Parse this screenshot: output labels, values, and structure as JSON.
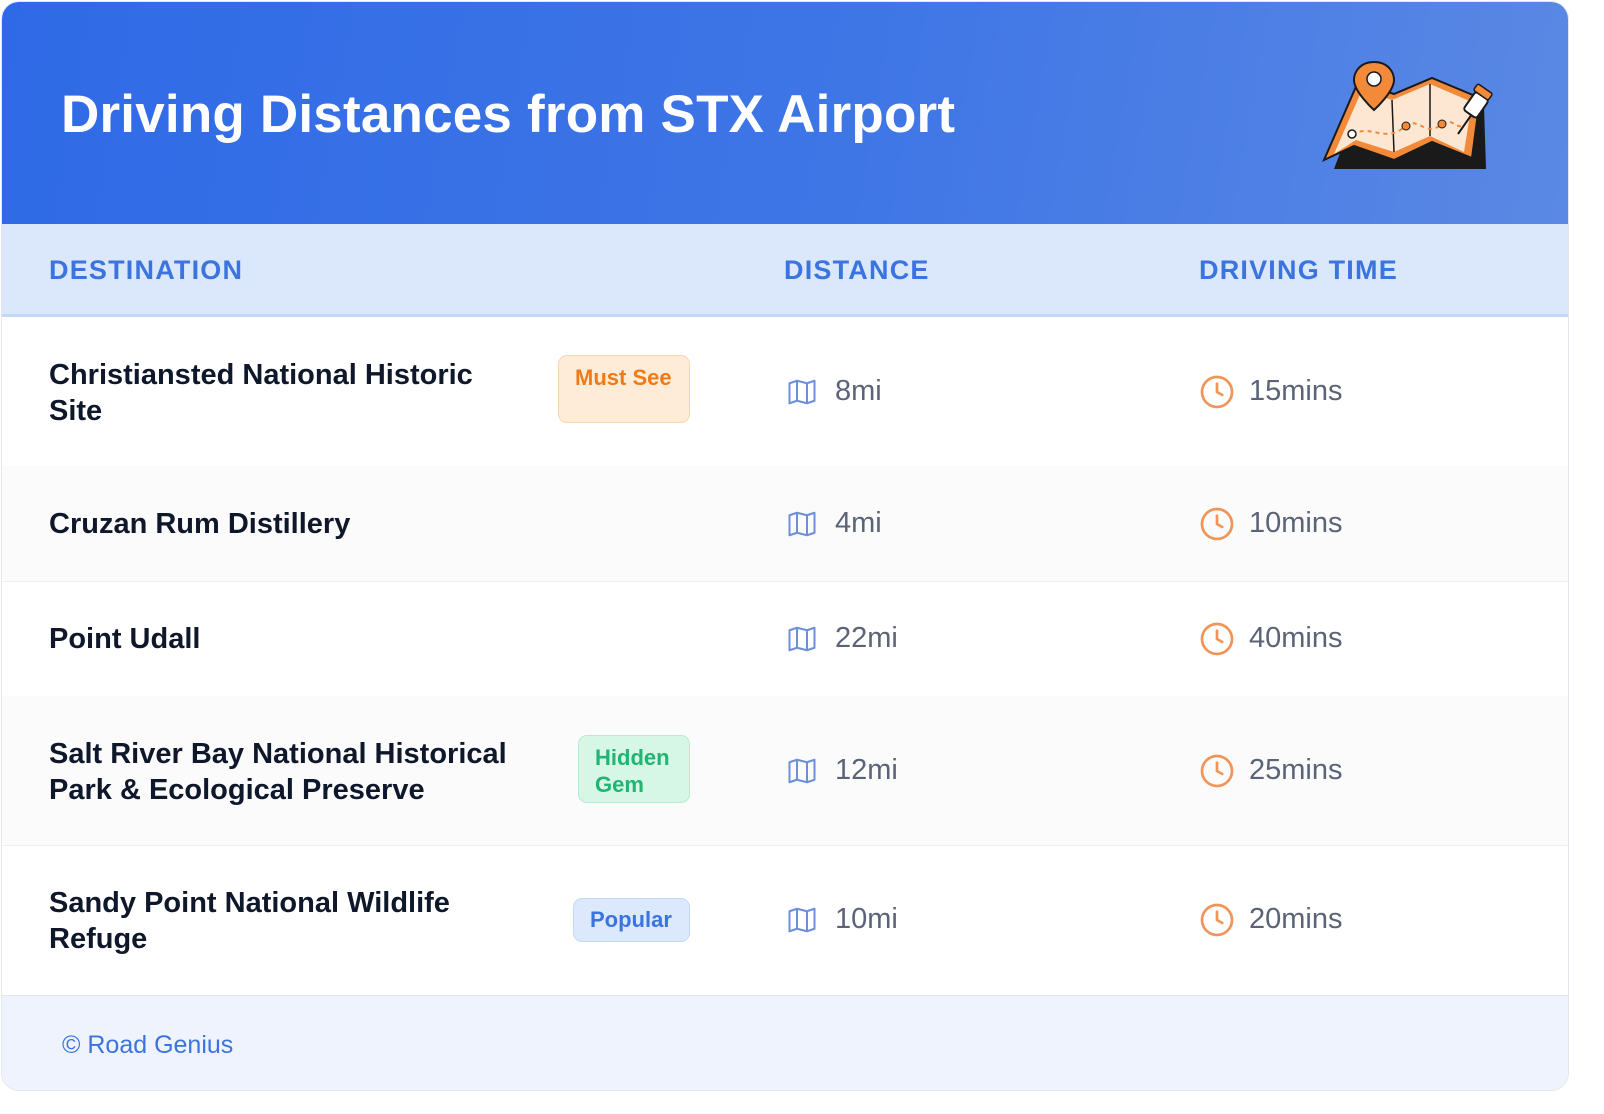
{
  "header": {
    "title": "Driving Distances from STX Airport",
    "illustration": "map-with-pins-icon"
  },
  "columns": {
    "destination": "DESTINATION",
    "distance": "DISTANCE",
    "driving_time": "DRIVING TIME"
  },
  "rows": [
    {
      "destination": "Christiansted National Historic Site",
      "badge": "Must See",
      "badge_color": "#ef7a16",
      "distance": "8mi",
      "time": "15mins"
    },
    {
      "destination": "Cruzan Rum Distillery",
      "badge": "",
      "distance": "4mi",
      "time": "10mins"
    },
    {
      "destination": "Point Udall",
      "badge": "",
      "distance": "22mi",
      "time": "40mins"
    },
    {
      "destination": "Salt River Bay National Historical Park & Ecological Preserve",
      "badge": "Hidden Gem",
      "badge_color": "#1fb573",
      "distance": "12mi",
      "time": "25mins"
    },
    {
      "destination": "Sandy Point National Wildlife Refuge",
      "badge": "Popular",
      "badge_color": "#3b74df",
      "distance": "10mi",
      "time": "20mins"
    }
  ],
  "icons": {
    "distance": "map-icon",
    "time": "clock-icon"
  },
  "colors": {
    "header_start": "#2f6ae6",
    "accent": "#3b74df",
    "clock": "#f0955a"
  },
  "footer": {
    "credit": "© Road Genius"
  }
}
